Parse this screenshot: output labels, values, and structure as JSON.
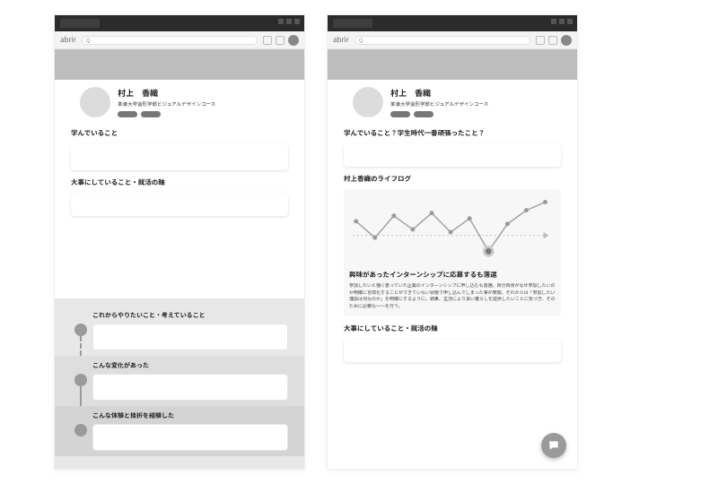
{
  "browser": {
    "brand": "abrir",
    "search_placeholder": "Q"
  },
  "profile": {
    "name": "村上　香織",
    "school": "某湊大学造形学部ビジュアルデザインコース"
  },
  "left": {
    "sections": {
      "learning": "学んでいること",
      "values": "大事にしていること・就活の軸"
    },
    "timeline": {
      "t1": "これからやりたいこと・考えていること",
      "t2": "こんな変化があった",
      "t3": "こんな体験と挫折を経験した"
    }
  },
  "right": {
    "sections": {
      "learning": "学んでいること？学生時代一番頑張ったこと？",
      "lifelog": "村上香織のライフログ",
      "values": "大事にしていること・就活の軸"
    },
    "lifelog": {
      "caption": "興味があったインターンシップに応募するも落選",
      "body": "参加したいと強く思っていた企業のインターンシップに申し込むも落選。自分自身がなぜ参加したいのか明確に言語化することができていない状態で申し込んでしまった事が原因。それからは「参加したい理由は何なのか」を明確にするように。結果、生活により良い暮らしを提供したいことに気づき、そのために必要な〜〜を行う。"
    }
  },
  "chart_data": {
    "type": "line",
    "x": [
      0,
      1,
      2,
      3,
      4,
      5,
      6,
      7,
      8,
      9,
      10
    ],
    "values": [
      20,
      -10,
      30,
      5,
      35,
      0,
      25,
      -35,
      15,
      40,
      55
    ],
    "highlight_index": 7,
    "title": "村上香織のライフログ",
    "xlabel": "",
    "ylabel": "",
    "ylim": [
      -50,
      60
    ]
  }
}
